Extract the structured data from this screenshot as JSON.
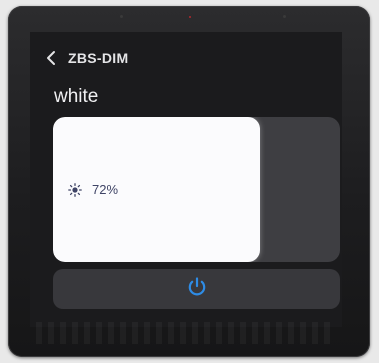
{
  "header": {
    "back_icon": "chevron-left-icon",
    "device_name": "ZBS-DIM"
  },
  "scene": {
    "title": "white"
  },
  "brightness": {
    "icon": "sun-icon",
    "label": "72%",
    "level": 0.72
  },
  "power": {
    "icon": "power-icon",
    "accent_color": "#2e8ce6"
  },
  "colors": {
    "screen_bg": "#1b1b1d",
    "slider_track": "#3e3e42",
    "slider_fill": "#fbfbfd",
    "panel_bg": "#38383c"
  }
}
